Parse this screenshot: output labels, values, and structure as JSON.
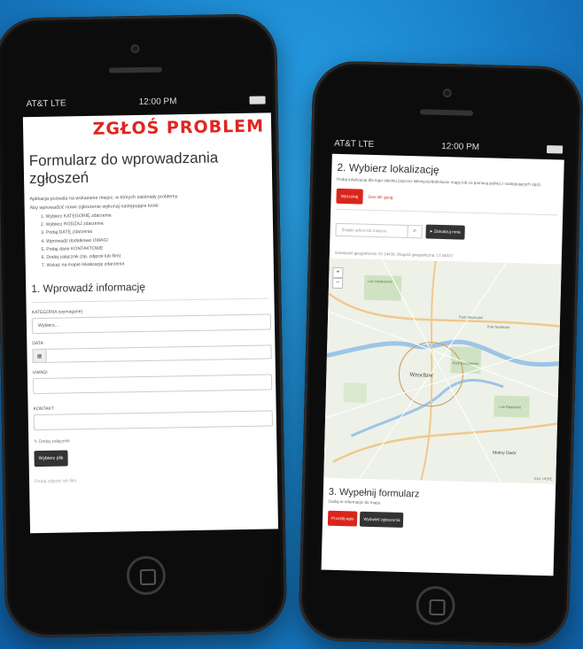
{
  "status_left": {
    "carrier": "AT&T LTE",
    "time": "12:00 PM"
  },
  "status_right": {
    "carrier": "AT&T LTE",
    "time": "12:00 PM"
  },
  "form": {
    "banner": "ZGŁOŚ PROBLEM",
    "title": "Formularz do wprowadzania zgłoszeń",
    "intro": "Aplikacja pozwala na wskazanie miejsc, w których zaistniały problemy.",
    "steps_intro": "Aby wprowadzić nowe zgłoszenie wykonaj następujące kroki:",
    "steps": [
      "1. Wybierz KATEGORIĘ zdarzenia",
      "2. Wybierz RODZAJ zdarzenia",
      "3. Podaj DATĘ zdarzenia",
      "4. Wprowadź dodatkowe UWAGI",
      "5. Podaj dane KONTAKTOWE",
      "6. Dodaj załącznik (np. zdjęcie lub film)",
      "7. Wskaż na mapie lokalizację zdarzenia"
    ],
    "section1_title": "1. Wprowadź informację",
    "category_label": "KATEGORIA (wymagane)",
    "category_value": "Wybierz...",
    "date_label": "DATA",
    "notes_label": "UWAGI",
    "contact_label": "KONTAKT",
    "attach_label": "Dodaj załącznik",
    "choose_file": "Wybierz plik",
    "attach_hint": "Dodaj zdjęcie lub film"
  },
  "location": {
    "section2_title": "2. Wybierz lokalizację",
    "section2_hint": "Podaj lokalizację dla tego obiektu poprzez kliknięcie/dotknięcie mapy lub za pomocą jednej z następujących opcji.",
    "tab_search": "Wyszukaj",
    "tab_coords": "Szer./dł. geog.",
    "search_placeholder": "Znajdź adres lub miejsce",
    "locate_me": "Zlokalizuj mnie",
    "coords_text": "Szerokość geograficzna: 51.14436, Długość geograficzna: 17.04022",
    "map_city": "Wrocław",
    "map_attribution": "Esri, HERE",
    "map_labels": [
      "Las Osobowicki",
      "Pole Maślickie",
      "Park Szczytnicki",
      "Las Rędziński",
      "Park Wschodni",
      "Mokry Dwór"
    ],
    "zoom_in": "+",
    "zoom_out": "−",
    "section3_title": "3. Wypełnij formularz",
    "section3_hint": "Dodaj te informacje do mapy.",
    "btn_submit": "Prześlij wpis",
    "btn_show": "Wyświetl zgłoszenia"
  },
  "colors": {
    "accent": "#d9261c",
    "background": "#1b86cf"
  }
}
